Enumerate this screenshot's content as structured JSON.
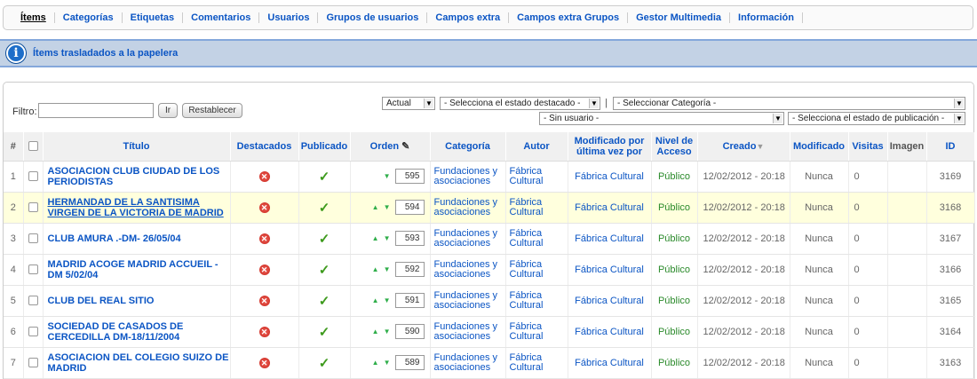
{
  "submenu": [
    {
      "label": "Ítems",
      "active": true
    },
    {
      "label": "Categorías"
    },
    {
      "label": "Etiquetas"
    },
    {
      "label": "Comentarios"
    },
    {
      "label": "Usuarios"
    },
    {
      "label": "Grupos de usuarios"
    },
    {
      "label": "Campos extra"
    },
    {
      "label": "Campos extra Grupos"
    },
    {
      "label": "Gestor Multimedia"
    },
    {
      "label": "Información"
    }
  ],
  "message": {
    "text": "Ítems trasladados a la papelera"
  },
  "filters": {
    "label": "Filtro:",
    "value": "",
    "go_label": "Ir",
    "reset_label": "Restablecer",
    "trash_select": "Actual",
    "featured_select": "- Selecciona el estado destacado -",
    "category_select": "- Seleccionar Categoría -",
    "author_select": "- Sin usuario -",
    "published_select": "- Selecciona el estado de publicación -",
    "pipe": "|"
  },
  "columns": {
    "num": "#",
    "title": "Título",
    "featured": "Destacados",
    "published": "Publicado",
    "order": "Orden",
    "category": "Categoría",
    "author": "Autor",
    "modified_by": "Modificado por última vez por",
    "access": "Nivel de Acceso",
    "created": "Creado",
    "modified": "Modificado",
    "hits": "Visitas",
    "image": "Imagen",
    "id": "ID"
  },
  "rows": [
    {
      "num": "1",
      "title": "ASOCIACION CLUB CIUDAD DE LOS PERIODISTAS",
      "order": "595",
      "has_up": false,
      "category": "Fundaciones y asociaciones",
      "author": "Fábrica Cultural",
      "modified_by": "Fábrica Cultural",
      "access": "Público",
      "created": "12/02/2012 - 20:18",
      "modified": "Nunca",
      "hits": "0",
      "id": "3169"
    },
    {
      "num": "2",
      "title": "HERMANDAD DE LA SANTISIMA VIRGEN DE LA VICTORIA DE MADRID",
      "order": "594",
      "has_up": true,
      "category": "Fundaciones y asociaciones",
      "author": "Fábrica Cultural",
      "modified_by": "Fábrica Cultural",
      "access": "Público",
      "created": "12/02/2012 - 20:18",
      "modified": "Nunca",
      "hits": "0",
      "id": "3168"
    },
    {
      "num": "3",
      "title": "CLUB AMURA .-DM- 26/05/04",
      "order": "593",
      "has_up": true,
      "category": "Fundaciones y asociaciones",
      "author": "Fábrica Cultural",
      "modified_by": "Fábrica Cultural",
      "access": "Público",
      "created": "12/02/2012 - 20:18",
      "modified": "Nunca",
      "hits": "0",
      "id": "3167"
    },
    {
      "num": "4",
      "title": "MADRID ACOGE MADRID ACCUEIL - DM 5/02/04",
      "order": "592",
      "has_up": true,
      "category": "Fundaciones y asociaciones",
      "author": "Fábrica Cultural",
      "modified_by": "Fábrica Cultural",
      "access": "Público",
      "created": "12/02/2012 - 20:18",
      "modified": "Nunca",
      "hits": "0",
      "id": "3166"
    },
    {
      "num": "5",
      "title": "CLUB DEL REAL SITIO",
      "order": "591",
      "has_up": true,
      "category": "Fundaciones y asociaciones",
      "author": "Fábrica Cultural",
      "modified_by": "Fábrica Cultural",
      "access": "Público",
      "created": "12/02/2012 - 20:18",
      "modified": "Nunca",
      "hits": "0",
      "id": "3165"
    },
    {
      "num": "6",
      "title": "SOCIEDAD DE CASADOS DE CERCEDILLA DM-18/11/2004",
      "order": "590",
      "has_up": true,
      "category": "Fundaciones y asociaciones",
      "author": "Fábrica Cultural",
      "modified_by": "Fábrica Cultural",
      "access": "Público",
      "created": "12/02/2012 - 20:18",
      "modified": "Nunca",
      "hits": "0",
      "id": "3164"
    },
    {
      "num": "7",
      "title": "ASOCIACION DEL COLEGIO SUIZO DE MADRID",
      "order": "589",
      "has_up": true,
      "category": "Fundaciones y asociaciones",
      "author": "Fábrica Cultural",
      "modified_by": "Fábrica Cultural",
      "access": "Público",
      "created": "12/02/2012 - 20:18",
      "modified": "Nunca",
      "hits": "0",
      "id": "3163"
    }
  ],
  "icons": {
    "info": "info-icon",
    "unfeatured": "unfeatured-x-icon",
    "published": "published-check-icon",
    "order_up": "arrow-up-icon",
    "order_down": "arrow-down-icon",
    "save_order": "save-order-icon",
    "sort": "sort-desc-icon"
  },
  "colors": {
    "link": "#0b55c4",
    "message_bg": "#c3d2e5",
    "highlight_row": "#ffffdd",
    "access_green": "#2a8a2a"
  }
}
